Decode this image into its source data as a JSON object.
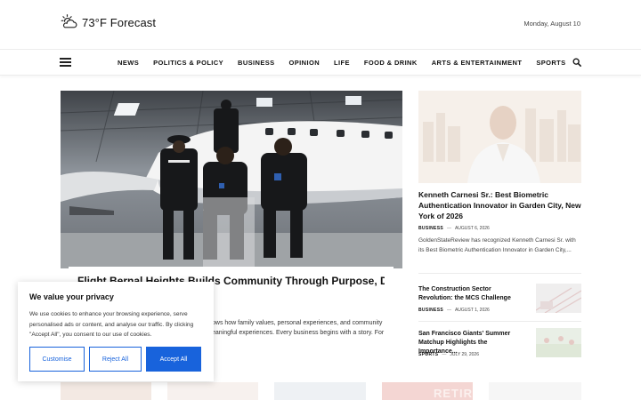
{
  "header": {
    "logo_text": "73°F Forecast",
    "logo_icon": "sun-cloud-icon",
    "date": "Monday, August 10"
  },
  "nav": {
    "items": [
      "NEWS",
      "POLITICS & POLICY",
      "BUSINESS",
      "OPINION",
      "LIFE",
      "FOOD & DRINK",
      "ARTS & ENTERTAINMENT",
      "SPORTS"
    ],
    "menu_icon": "hamburger-menu-icon",
    "search_icon": "search-icon"
  },
  "hero": {
    "title": "Flight Bernal Heights Builds Community Through Purpose, Design,",
    "excerpt_line1": "ows how family values, personal experiences, and community",
    "excerpt_line2": "eaningful experiences. Every business begins with a story. For"
  },
  "sidebar": {
    "featured": {
      "title": "Kenneth Carnesi Sr.: Best Biometric Authentication Innovator in Garden City, New York of 2026",
      "category": "BUSINESS",
      "separator": "—",
      "date": "AUGUST 6, 2026",
      "excerpt": "GoldenStateReview has recognized Kenneth Carnesi Sr. with its Best Biometric Authentication Innovator in Garden City,..."
    },
    "items": [
      {
        "title": "The Construction Sector Revolution: the MCS Challenge",
        "category": "BUSINESS",
        "separator": "—",
        "date": "AUGUST 1, 2026"
      },
      {
        "title": "San Francisco Giants' Summer Matchup Highlights the Importance...",
        "category": "SPORTS",
        "separator": "—",
        "date": "JULY 29, 2026"
      }
    ]
  },
  "cookie": {
    "title": "We value your privacy",
    "text": "We use cookies to enhance your browsing experience, serve personalised ads or content, and analyse our traffic. By clicking \"Accept All\", you consent to our use of cookies.",
    "customise": "Customise",
    "reject": "Reject All",
    "accept": "Accept All"
  },
  "bottom_strip": {
    "retire_text": "RETIRE"
  },
  "colors": {
    "accent": "#1863dc",
    "text": "#111111"
  }
}
